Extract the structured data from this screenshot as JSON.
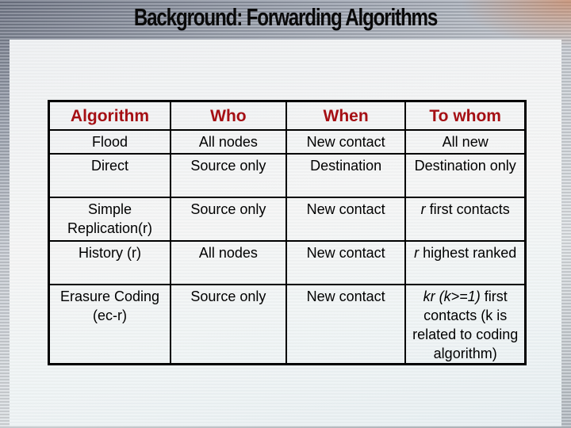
{
  "slide": {
    "title": "Background: Forwarding Algorithms"
  },
  "colors": {
    "header_text": "#a50f14",
    "body_text": "#000000"
  },
  "table": {
    "headers": [
      "Algorithm",
      "Who",
      "When",
      "To whom"
    ],
    "rows": [
      {
        "algorithm": "Flood",
        "who": "All nodes",
        "when": "New contact",
        "to_whom": "All new"
      },
      {
        "algorithm": "Direct",
        "who": "Source only",
        "when": "Destination",
        "to_whom": "Destination only"
      },
      {
        "algorithm": "Simple Replication(r)",
        "who": "Source only",
        "when": "New contact",
        "to_whom_italic": "r",
        "to_whom_rest": " first contacts"
      },
      {
        "algorithm": "History (r)",
        "who": "All nodes",
        "when": "New contact",
        "to_whom_italic": "r",
        "to_whom_rest": " highest ranked"
      },
      {
        "algorithm": "Erasure Coding (ec-r)",
        "who": "Source only",
        "when": "New contact",
        "to_whom_italic": "kr (k>=1)",
        "to_whom_rest": " first contacts (k is related to coding algorithm)"
      }
    ]
  }
}
